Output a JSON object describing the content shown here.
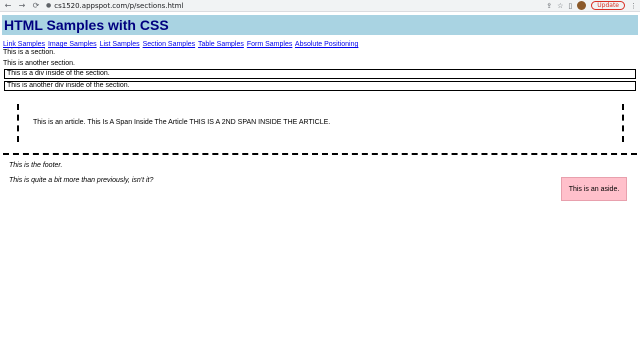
{
  "browser": {
    "url": "cs1520.appspot.com/p/sections.html",
    "update_label": "Update",
    "back_icon": "←",
    "forward_icon": "→",
    "reload_icon": "⟳",
    "lock_icon": "🔒",
    "share_icon": "⇪",
    "star_icon": "☆",
    "sidebar_icon": "▯",
    "menu_icon": "⋮"
  },
  "header": {
    "title": "HTML Samples with CSS"
  },
  "nav": {
    "links": [
      "Link Samples",
      "Image Samples",
      "List Samples",
      "Section Samples",
      "Table Samples",
      "Form Samples",
      "Absolute Positioning"
    ]
  },
  "sections": {
    "first": "This is a section.",
    "second": "This is another section.",
    "div1": "This is a div inside of the section.",
    "div2": "This is another div inside of the section."
  },
  "article": {
    "text": "This is an article. This Is A Span Inside The Article THIS IS A 2ND SPAN INSIDE THE ARTICLE."
  },
  "footer": {
    "line1": "This is the footer.",
    "line2": "This is quite a bit more than previously, isn't it?"
  },
  "aside": {
    "text": "This is an aside."
  },
  "colors": {
    "header_bg": "#a9d3e2",
    "header_text": "#000080",
    "link": "#0000ee",
    "aside_bg": "#ffc0cb",
    "update_red": "#d93025"
  }
}
